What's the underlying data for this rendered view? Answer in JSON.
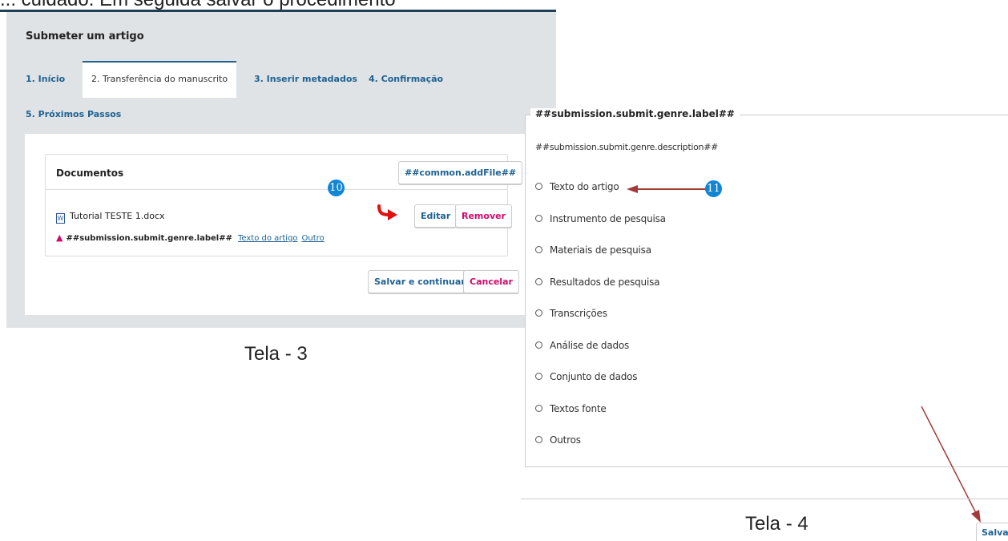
{
  "top_caption": "... cuidado. Em seguida salvar o procedimento",
  "tela3": {
    "title": "Submeter um artigo",
    "tabs": [
      "1. Início",
      "2. Transferência do manuscrito",
      "3. Inserir metadados",
      "4. Confirmação",
      "5. Próximos Passos"
    ],
    "active_tab": 1,
    "documents_title": "Documentos",
    "add_file_label": "##common.addFile##",
    "file_name": "Tutorial TESTE 1.docx",
    "genre_label": "##submission.submit.genre.label##",
    "genre_links": [
      "Texto do artigo",
      "Outro"
    ],
    "edit_label": "Editar",
    "remove_label": "Remover",
    "save_continue_label": "Salvar e continuar",
    "cancel_label": "Cancelar",
    "badge": "10",
    "caption": "Tela - 3"
  },
  "tela4": {
    "legend": "##submission.submit.genre.label##",
    "description": "##submission.submit.genre.description##",
    "options": [
      "Texto do artigo",
      "Instrumento de pesquisa",
      "Materiais de pesquisa",
      "Resultados de pesquisa",
      "Transcrições",
      "Análise de dados",
      "Conjunto de dados",
      "Textos fonte",
      "Outros"
    ],
    "badge": "11",
    "caption": "Tela - 4",
    "save_label": "Salvar"
  },
  "colors": {
    "link": "#1e6292",
    "danger": "#d00a6c",
    "badge": "#1186d4",
    "annotation_arrow": "#a33a3a",
    "pointer_arrow": "#e01010"
  },
  "icons": [
    "word-file-icon",
    "warning-icon",
    "radio-icon",
    "pointer-arrow-icon",
    "annotation-arrow-icon"
  ]
}
